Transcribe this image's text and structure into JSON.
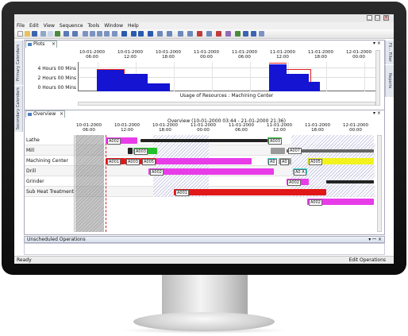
{
  "menu": [
    "File",
    "Edit",
    "View",
    "Sequence",
    "Tools",
    "Window",
    "Help"
  ],
  "window_controls": [
    "_",
    "□",
    "×"
  ],
  "side_tabs": {
    "primary": "Primary Calendars",
    "secondary": "Secondary Calendars"
  },
  "right_tabs": {
    "top": "Fil... Filter",
    "reports": "Reports"
  },
  "plots_pane": {
    "tab_label": "Plots",
    "close": "×",
    "timeline": [
      {
        "date": "10-01-2000",
        "time": "06:00"
      },
      {
        "date": "10-01-2000",
        "time": "12:00"
      },
      {
        "date": "10-01-2000",
        "time": "18:00"
      },
      {
        "date": "11-01-2000",
        "time": "00:00"
      },
      {
        "date": "11-01-2000",
        "time": "06:00"
      },
      {
        "date": "11-01-2000",
        "time": "12:00"
      },
      {
        "date": "11-01-2000",
        "time": "18:00"
      },
      {
        "date": "12-01-2000",
        "time": "00:00"
      }
    ],
    "y_labels": [
      "4 Hours 00 Mins",
      "2 Hours 00 Mins",
      "0 Hours 00 Mins"
    ],
    "caption": "Usage of Resources : Machining Center"
  },
  "overview_pane": {
    "tab_label": "Overview",
    "close": "×",
    "range_title": "Overview  (10-01-2000 03:44 - 21-01-2000 21:36)",
    "timeline": [
      {
        "date": "10-01-2000",
        "time": "06:00"
      },
      {
        "date": "10-01-2000",
        "time": "12:00"
      },
      {
        "date": "10-01-2000",
        "time": "18:00"
      },
      {
        "date": "11-01-2000",
        "time": "00:00"
      },
      {
        "date": "11-01-2000",
        "time": "06:00"
      },
      {
        "date": "11-01-2000",
        "time": "12:00"
      },
      {
        "date": "11-01-2000",
        "time": "18:00"
      },
      {
        "date": "12-01-2000",
        "time": "00:00"
      }
    ],
    "resources": [
      "Lathe",
      "Mill",
      "Machining Center",
      "Drill",
      "Grinder",
      "Sub Heat Treatment"
    ],
    "ops": {
      "lathe_a": "A002",
      "lathe_b": "A003",
      "mill_a": "A003",
      "mill_b": "A007",
      "mc_a": "A001",
      "mc_b": "A003",
      "mc_c": "A005",
      "mc_d": "A0",
      "mc_e": "A0",
      "mc_f": "A005",
      "drill_a": "A002",
      "drill_b": "A0 A",
      "grinder_a": "A002",
      "sht_a": "A001",
      "sht_b": "A002"
    }
  },
  "unscheduled": {
    "label": "Unscheduled Operations",
    "controls": "▾ ꟷ ×"
  },
  "status": {
    "left": "Ready",
    "right": "Edit Operations"
  },
  "colors": {
    "blue_bar": "#1414d2",
    "red_line": "#e02020",
    "green": "#22c02a",
    "magenta": "#e83ce8",
    "red": "#e01818",
    "yellow": "#f2f21c",
    "cyan": "#30d8d8",
    "black": "#222222",
    "hatch": "#b8b8de"
  }
}
